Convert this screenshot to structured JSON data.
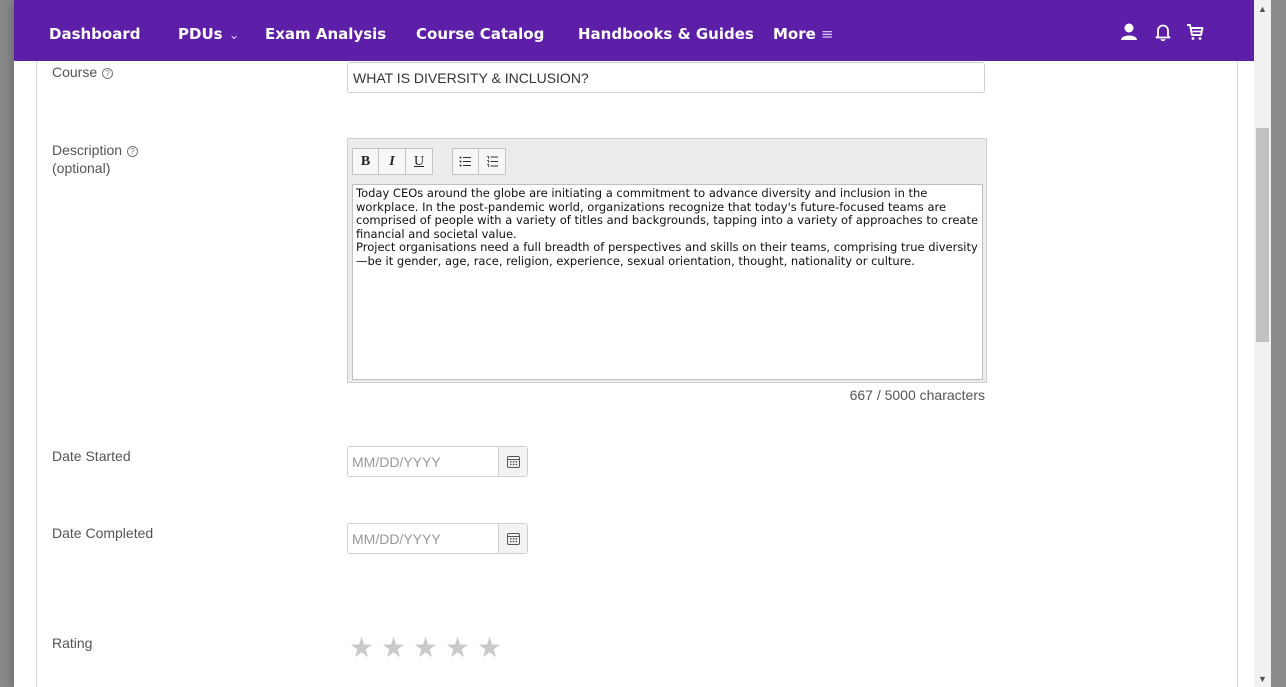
{
  "nav": {
    "dashboard": "Dashboard",
    "pdus": "PDUs",
    "exam_analysis": "Exam Analysis",
    "course_catalog": "Course Catalog",
    "handbooks": "Handbooks & Guides",
    "more": "More"
  },
  "nav_icons": [
    "user-icon",
    "bell-icon",
    "cart-icon"
  ],
  "form": {
    "course_label": "Course",
    "course_value": "WHAT IS DIVERSITY & INCLUSION?",
    "description_label": "Description",
    "description_optional": "(optional)",
    "toolbar": {
      "bold": "B",
      "italic": "I",
      "underline": "U"
    },
    "description_paragraphs": [
      "Today CEOs around the globe are initiating a commitment to advance diversity and inclusion in the workplace. In the post-pandemic world, organizations recognize that today's future-focused teams are comprised of people with a variety of titles and backgrounds, tapping into a variety of approaches to create financial and societal value.",
      "Project organisations need a full breadth of perspectives and skills on their teams, comprising true diversity—be it gender, age, race, religion, experience, sexual orientation, thought, nationality or culture."
    ],
    "char_count": "667 / 5000 characters",
    "date_started_label": "Date Started",
    "date_started_placeholder": "MM/DD/YYYY",
    "date_completed_label": "Date Completed",
    "date_completed_placeholder": "MM/DD/YYYY",
    "rating_label": "Rating",
    "rating_value": 0,
    "rating_max": 5
  },
  "colors": {
    "navbar": "#5d1ea8",
    "star_empty": "#cacaca"
  }
}
